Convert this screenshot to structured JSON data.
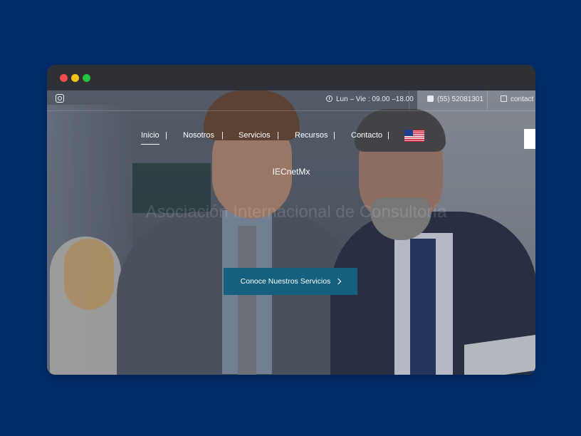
{
  "topbar": {
    "hours": "Lun – Vie : 09.00 –18.00",
    "phone": "(55) 52081301",
    "email": "contact"
  },
  "nav": {
    "items": [
      {
        "label": "Inicio",
        "active": true
      },
      {
        "label": "Nosotros"
      },
      {
        "label": "Servicios"
      },
      {
        "label": "Recursos"
      },
      {
        "label": "Contacto"
      }
    ],
    "pipe": "|",
    "language_flag": "us-flag-icon"
  },
  "hero": {
    "brand": "IECnetMx",
    "headline": "Asociación Internacional de Consultoría",
    "cta_label": "Conoce Nuestros Servicios"
  },
  "colors": {
    "page_bg": "#022d6c",
    "cta_bg": "#13607f",
    "titlebar": "#2f3035"
  }
}
